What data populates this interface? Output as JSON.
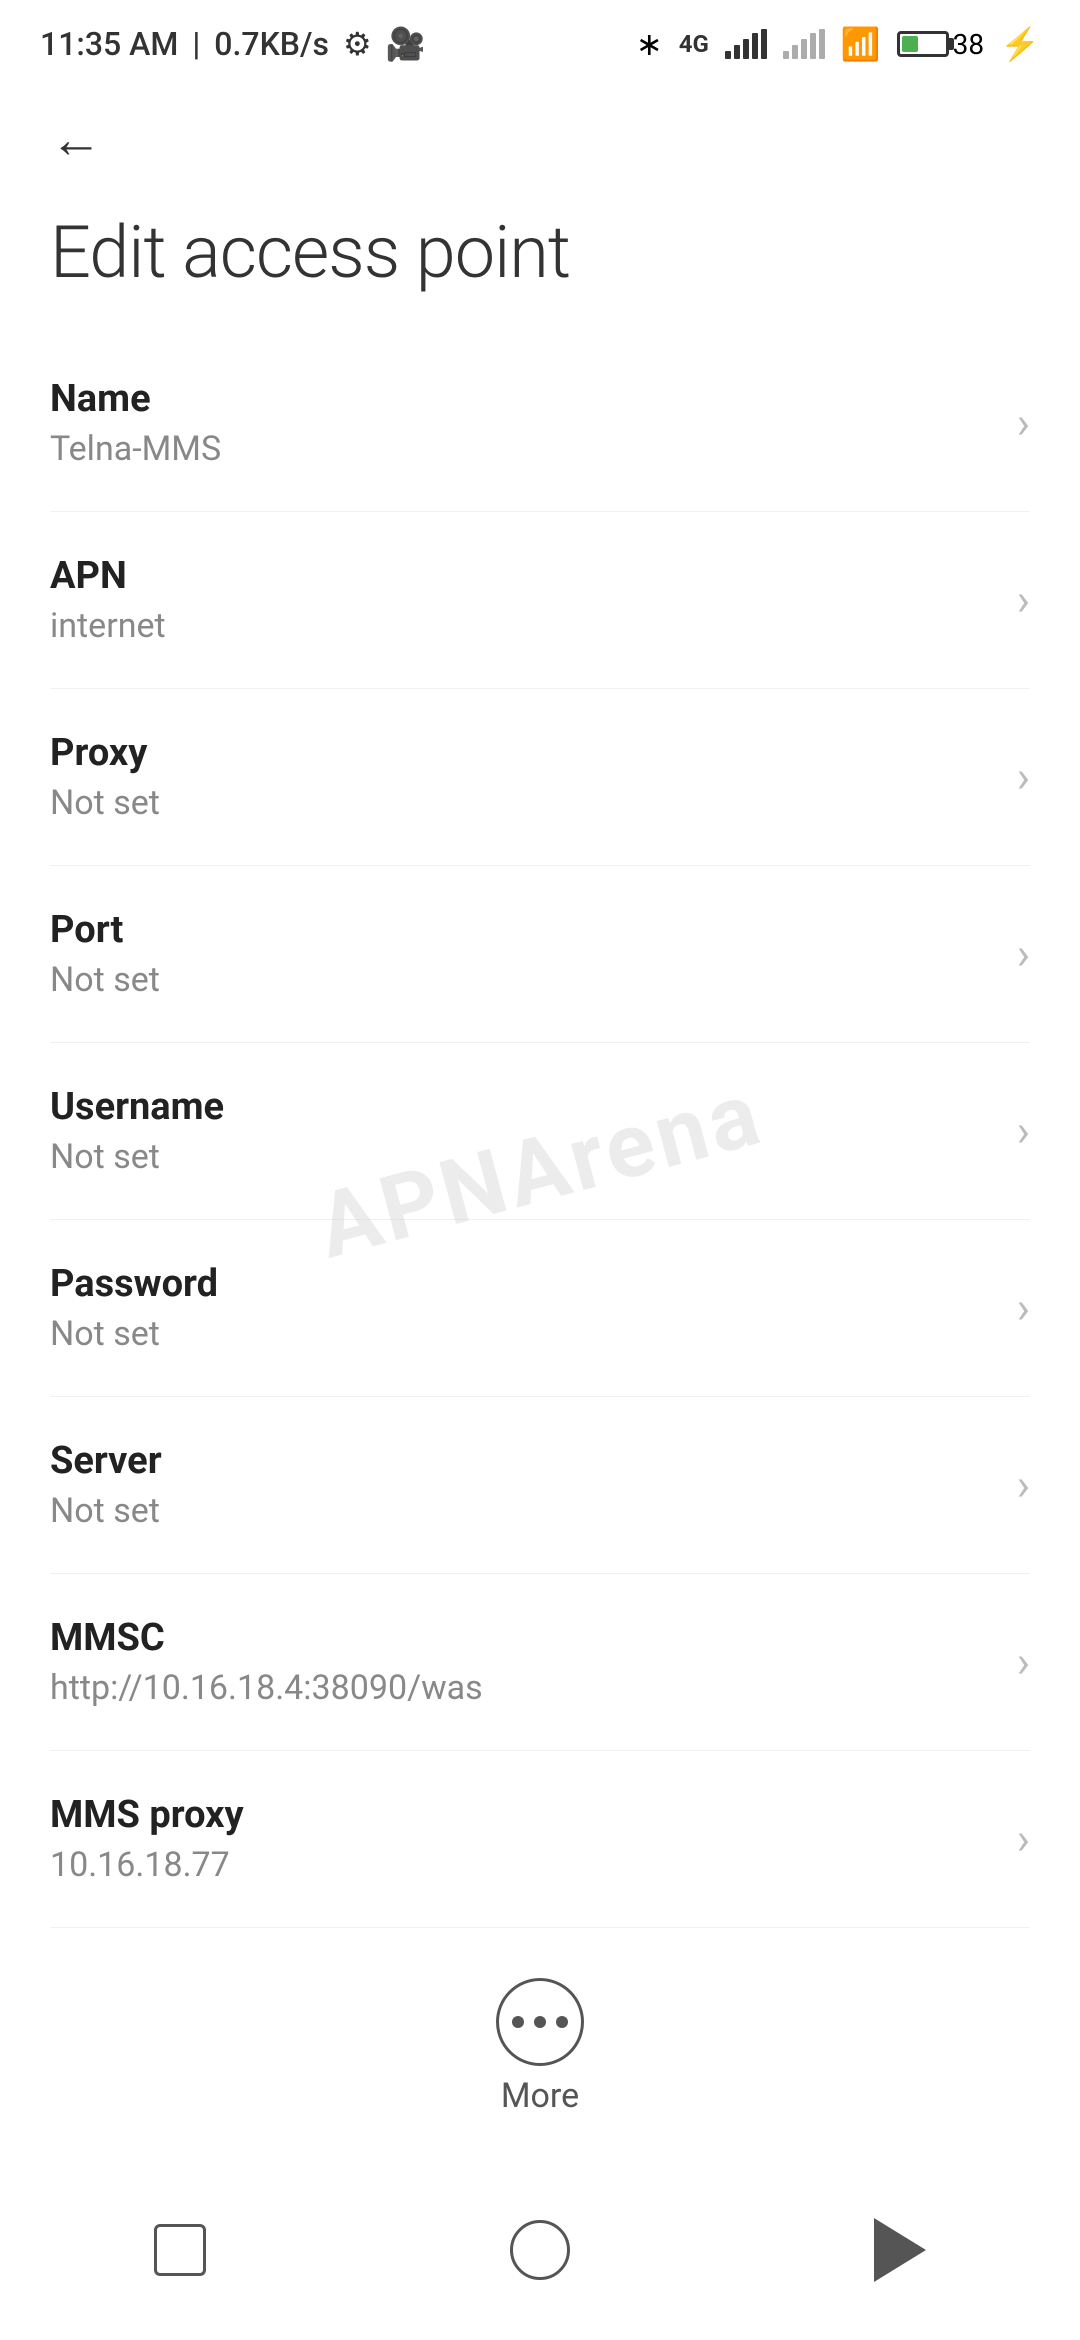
{
  "statusBar": {
    "time": "11:35 AM",
    "speed": "0.7KB/s",
    "battery": "38"
  },
  "nav": {
    "backLabel": "←"
  },
  "page": {
    "title": "Edit access point"
  },
  "settings": [
    {
      "label": "Name",
      "value": "Telna-MMS"
    },
    {
      "label": "APN",
      "value": "internet"
    },
    {
      "label": "Proxy",
      "value": "Not set"
    },
    {
      "label": "Port",
      "value": "Not set"
    },
    {
      "label": "Username",
      "value": "Not set"
    },
    {
      "label": "Password",
      "value": "Not set"
    },
    {
      "label": "Server",
      "value": "Not set"
    },
    {
      "label": "MMSC",
      "value": "http://10.16.18.4:38090/was"
    },
    {
      "label": "MMS proxy",
      "value": "10.16.18.77"
    }
  ],
  "more": {
    "label": "More"
  },
  "watermark": "APNArena"
}
